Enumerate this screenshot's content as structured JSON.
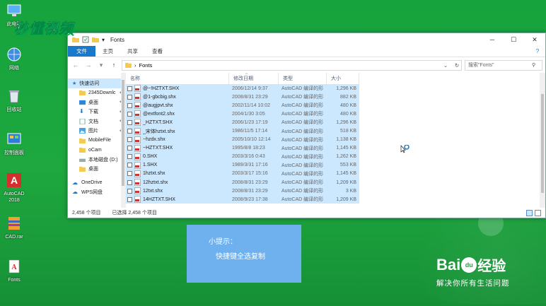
{
  "watermark": "秒懂视频",
  "desktop_icons": [
    {
      "label": "此电脑"
    },
    {
      "label": "网络"
    },
    {
      "label": "回收站"
    },
    {
      "label": "控制面板"
    },
    {
      "label": "AutoCAD 2018"
    },
    {
      "label": "CAD.rar"
    },
    {
      "label": "Fonts"
    }
  ],
  "window": {
    "title": "Fonts",
    "ribbon_tabs": [
      "文件",
      "主页",
      "共享",
      "查看"
    ],
    "address": "Fonts",
    "search_placeholder": "搜索\"Fonts\"",
    "nav_items": [
      {
        "label": "快速访问",
        "selected": true
      },
      {
        "label": "2345Downlc",
        "pinned": true
      },
      {
        "label": "桌面",
        "pinned": true
      },
      {
        "label": "下载",
        "pinned": true
      },
      {
        "label": "文档",
        "pinned": true
      },
      {
        "label": "图片",
        "pinned": true
      },
      {
        "label": "MobileFile"
      },
      {
        "label": "oCam"
      },
      {
        "label": "本地磁盘 (D:)"
      },
      {
        "label": "桌面"
      },
      {
        "label": ""
      },
      {
        "label": "OneDrive"
      },
      {
        "label": "WPS网盘"
      }
    ],
    "columns": {
      "name": "名称",
      "date": "修改日期",
      "type": "类型",
      "size": "大小"
    },
    "files": [
      {
        "name": "@~!HZTXT.SHX",
        "date": "2006/12/14 9:37",
        "type": "AutoCAD 编译的形",
        "size": "1,296 KB"
      },
      {
        "name": "@1-gbcbig.shx",
        "date": "2008/8/31 23:29",
        "type": "AutoCAD 编译的形",
        "size": "882 KB"
      },
      {
        "name": "@augjpvt.shx",
        "date": "2002/11/14 10:02",
        "type": "AutoCAD 编译的形",
        "size": "480 KB"
      },
      {
        "name": "@extfont2.shx",
        "date": "2004/1/30 3:05",
        "type": "AutoCAD 编译的形",
        "size": "480 KB"
      },
      {
        "name": "_HZTXT.SHX",
        "date": "2006/1/23 17:19",
        "type": "AutoCAD 编译的形",
        "size": "1,296 KB"
      },
      {
        "name": "_宋体hztxt.shx",
        "date": "1986/11/5 17:14",
        "type": "AutoCAD 编译的形",
        "size": "518 KB"
      },
      {
        "name": "~hzdx.shx",
        "date": "2005/10/10 12:14",
        "type": "AutoCAD 编译的形",
        "size": "1,138 KB"
      },
      {
        "name": "~HZTXT.SHX",
        "date": "1995/8/8 18:23",
        "type": "AutoCAD 编译的形",
        "size": "1,145 KB"
      },
      {
        "name": "0.SHX",
        "date": "2003/3/16 0:43",
        "type": "AutoCAD 编译的形",
        "size": "1,262 KB"
      },
      {
        "name": "1.SHX",
        "date": "1989/3/31 17:16",
        "type": "AutoCAD 编译的形",
        "size": "553 KB"
      },
      {
        "name": "1hztxt.shx",
        "date": "2003/3/17 15:16",
        "type": "AutoCAD 编译的形",
        "size": "1,145 KB"
      },
      {
        "name": "12hztxt.shx",
        "date": "2008/8/31 23:29",
        "type": "AutoCAD 编译的形",
        "size": "1,209 KB"
      },
      {
        "name": "12txt.shx",
        "date": "2008/8/31 23:29",
        "type": "AutoCAD 编译的形",
        "size": "3 KB"
      },
      {
        "name": "14HZTXT.SHX",
        "date": "2008/9/23 17:38",
        "type": "AutoCAD 编译的形",
        "size": "1,209 KB"
      }
    ],
    "status_count": "2,458 个项目",
    "status_selected": "已选择 2,458 个项目"
  },
  "tip": {
    "title": "小提示：",
    "text": "快捷键全选复制"
  },
  "baidu": {
    "logo_left": "Bai",
    "logo_paw": "du",
    "logo_right": "经验",
    "slogan": "解决你所有生活问题"
  }
}
